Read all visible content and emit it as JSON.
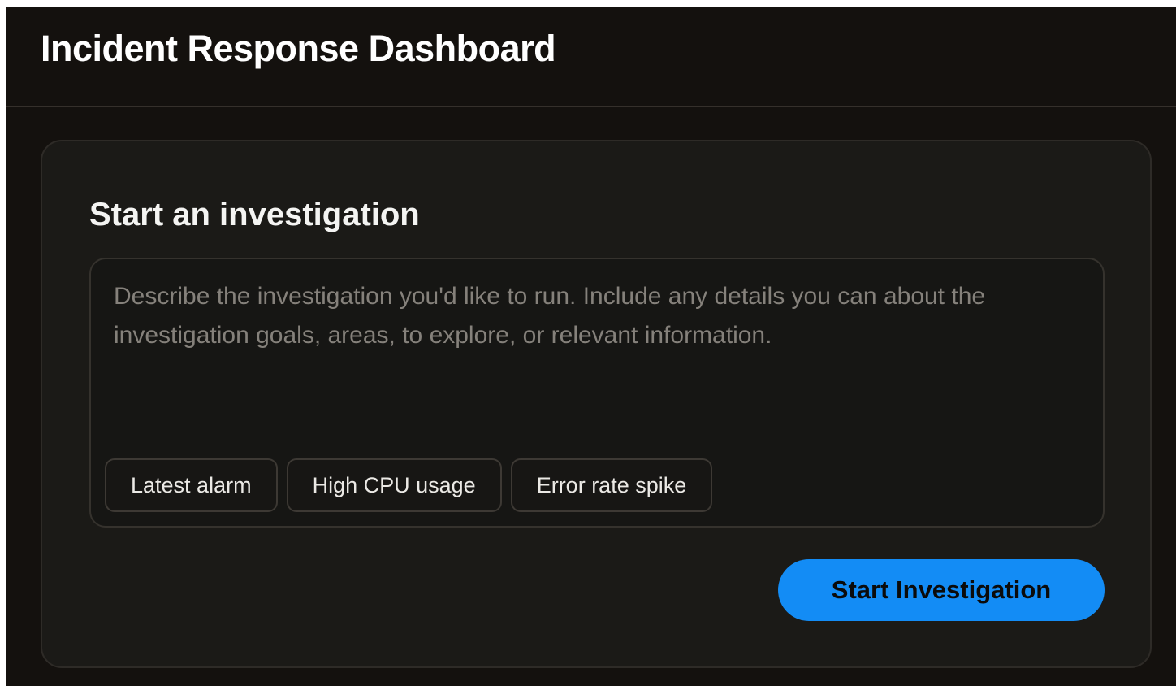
{
  "header": {
    "title": "Incident Response Dashboard"
  },
  "investigation": {
    "title": "Start an investigation",
    "description_value": "",
    "description_placeholder": "Describe the investigation you'd like to run. Include any details you can about the investigation goals, areas, to explore, or relevant information.",
    "suggestions": [
      {
        "label": "Latest alarm"
      },
      {
        "label": "High CPU usage"
      },
      {
        "label": "Error rate spike"
      }
    ],
    "start_label": "Start Investigation"
  },
  "colors": {
    "background": "#14110e",
    "card": "#1b1a17",
    "accent": "#138cf5"
  }
}
